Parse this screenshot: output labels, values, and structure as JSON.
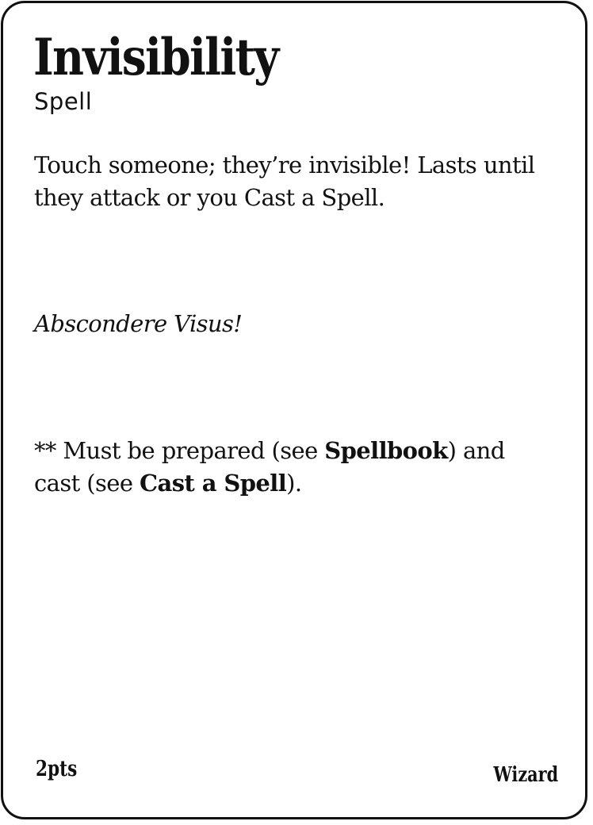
{
  "card": {
    "title": "Invisibility",
    "type": "Spell",
    "description": "Touch someone; they’re invisible! Lasts until they attack or you Cast a Spell.",
    "incantation": "Abscondere Visus!",
    "note": {
      "prefix": "** Must be prepared (see ",
      "ref1": "Spellbook",
      "middle": ") and cast (see ",
      "ref2": "Cast a Spell",
      "suffix": ")."
    },
    "points": "2pts",
    "class": "Wizard"
  }
}
